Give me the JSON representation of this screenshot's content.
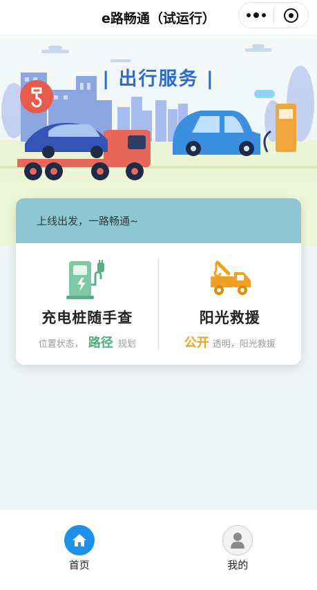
{
  "topbar": {
    "title": "e路畅通（试运行）",
    "more_icon": "more-dots-icon",
    "close_icon": "target-circle-icon"
  },
  "banner": {
    "title": "出行服务",
    "title_color": "#2d6bd0"
  },
  "card": {
    "header_text": "上线出发，一路畅通~",
    "header_color": "#8ec6d3",
    "features": [
      {
        "title": "充电桩随手查",
        "sub_before": "位置状态，",
        "sub_highlight": "路径",
        "sub_after": "规划",
        "highlight_color": "#4bb07a",
        "icon": "charging-station-icon"
      },
      {
        "title": "阳光救援",
        "sub_before": "",
        "sub_highlight": "公开",
        "sub_after": "透明，阳光救援",
        "highlight_color": "#f0a024",
        "icon": "tow-truck-icon"
      }
    ]
  },
  "tabbar": {
    "items": [
      {
        "label": "首页",
        "icon": "home-icon",
        "active": true,
        "color": "#1e90e8"
      },
      {
        "label": "我的",
        "icon": "user-icon",
        "active": false
      }
    ]
  }
}
